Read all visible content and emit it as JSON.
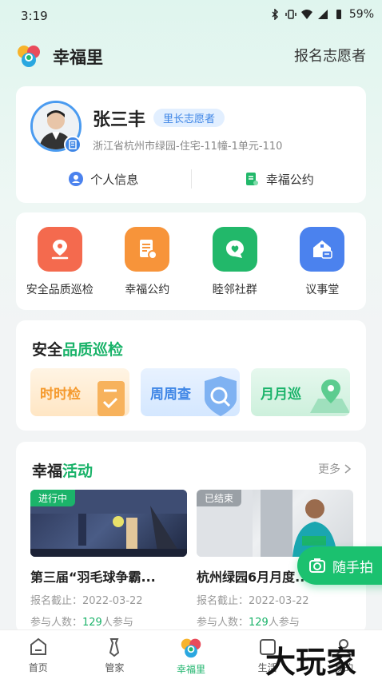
{
  "status_bar": {
    "time": "3:19",
    "battery": "59%"
  },
  "header": {
    "title": "幸福里",
    "register_label": "报名志愿者"
  },
  "profile": {
    "name": "张三丰",
    "role": "里长志愿者",
    "address": "浙江省杭州市绿园-住宅-11幢-1单元-110",
    "actions": [
      {
        "label": "个人信息",
        "icon": "person-icon"
      },
      {
        "label": "幸福公约",
        "icon": "document-icon"
      }
    ]
  },
  "shortcuts": [
    {
      "label": "安全品质巡检",
      "icon": "location-icon",
      "color": "#f46a4e"
    },
    {
      "label": "幸福公约",
      "icon": "document-icon",
      "color": "#f7943a"
    },
    {
      "label": "睦邻社群",
      "icon": "chat-heart-icon",
      "color": "#22b86a"
    },
    {
      "label": "议事堂",
      "icon": "house-chat-icon",
      "color": "#4b82ee"
    }
  ],
  "patrol": {
    "title_plain": "安全",
    "title_highlight": "品质巡检",
    "buttons": [
      {
        "label": "时时检",
        "color": "#f59a2e"
      },
      {
        "label": "周周查",
        "color": "#3f86e6"
      },
      {
        "label": "月月巡",
        "color": "#1bb36a"
      }
    ]
  },
  "activities": {
    "title_plain": "幸福",
    "title_highlight": "活动",
    "more_label": "更多",
    "items": [
      {
        "status": "进行中",
        "title": "第三届“羽毛球争霸...",
        "deadline": "报名截止：2022-03-22",
        "participants_prefix": "参与人数：",
        "participants": "129",
        "participants_suffix": "人参与"
      },
      {
        "status": "已结束",
        "title": "杭州绿园6月月度...",
        "deadline": "报名截止：2022-03-22",
        "participants_prefix": "参与人数：",
        "participants": "129",
        "participants_suffix": "人参与"
      }
    ]
  },
  "float_button": {
    "label": "随手拍"
  },
  "tabs": [
    {
      "label": "首页",
      "icon": "home-icon"
    },
    {
      "label": "管家",
      "icon": "tie-icon"
    },
    {
      "label": "幸福里",
      "icon": "logo-icon",
      "active": true
    },
    {
      "label": "生活",
      "icon": "life-icon"
    },
    {
      "label": "我的",
      "icon": "user-icon"
    }
  ],
  "watermark": "大玩家"
}
